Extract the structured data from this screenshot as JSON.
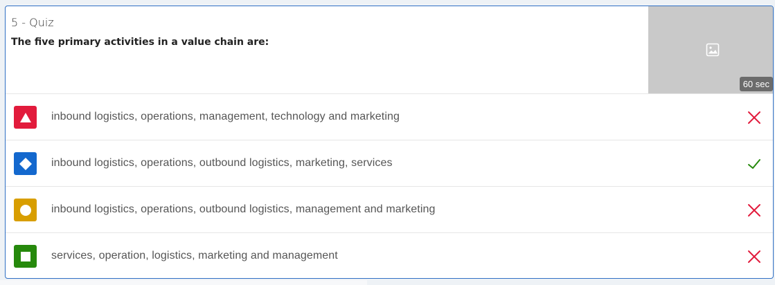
{
  "question": {
    "number_label": "5 - Quiz",
    "text": "The five primary activities in a value chain are:"
  },
  "media": {
    "placeholder_icon": "image-icon",
    "timer_label": "60 sec"
  },
  "colors": {
    "red": "#e21b3c",
    "blue": "#1368ce",
    "yellow": "#d89e00",
    "green": "#26890c",
    "wrong_mark": "#e21b3c",
    "correct_mark": "#26890c"
  },
  "answers": [
    {
      "shape": "triangle-icon",
      "text": "inbound logistics, operations, management, technology and marketing",
      "correct": false
    },
    {
      "shape": "diamond-icon",
      "text": "inbound logistics, operations, outbound logistics, marketing, services",
      "correct": true
    },
    {
      "shape": "circle-icon",
      "text": "inbound logistics, operations, outbound logistics, management and marketing",
      "correct": false
    },
    {
      "shape": "square-icon",
      "text": "services, operation, logistics, marketing and management",
      "correct": false
    }
  ]
}
